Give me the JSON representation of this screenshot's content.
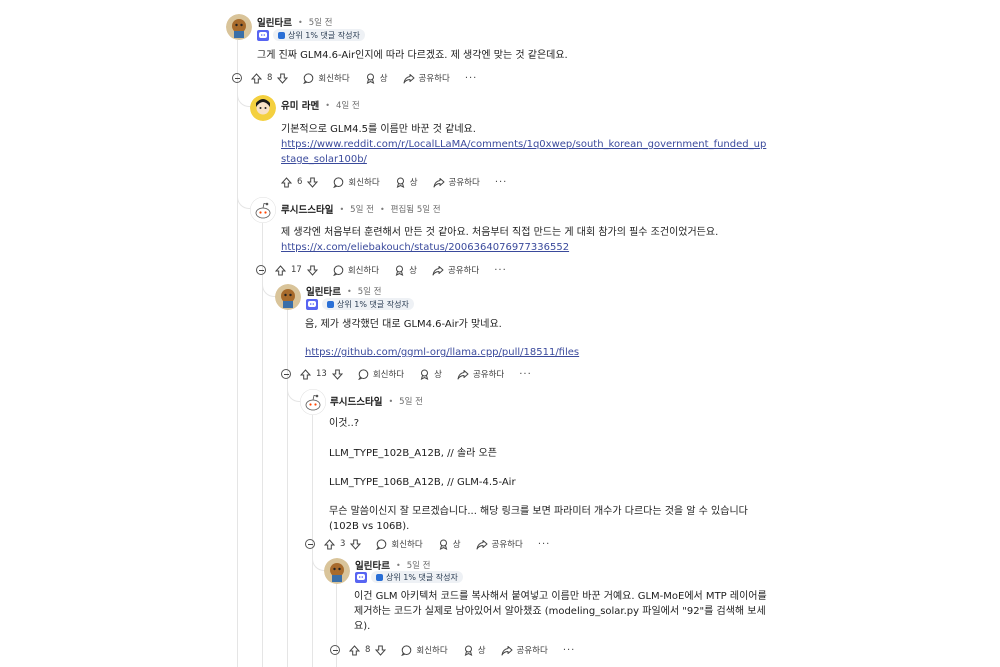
{
  "comments": [
    {
      "author": "일린타르",
      "time": "5일 전",
      "flair": "상위 1% 댓글 작성자",
      "body": [
        "그게 진짜 GLM4.6-Air인지에 따라 다르겠죠. 제 생각엔 맞는 것 같은데요."
      ],
      "votes": "8"
    },
    {
      "author": "유미 라멘",
      "time": "4일 전",
      "body": [
        "기본적으로 GLM4.5를 이름만 바꾼 것 같네요."
      ],
      "link": "https://www.reddit.com/r/LocalLLaMA/comments/1q0xwep/south_korean_government_funded_upstage_solar100b/",
      "votes": "6"
    },
    {
      "author": "루시드스타일",
      "time": "5일 전",
      "edited": "편집됨 5일 전",
      "body": [
        "제 생각엔 처음부터 훈련해서 만든 것 같아요. 처음부터 직접 만드는 게 대회 참가의 필수 조건이었거든요."
      ],
      "link": "https://x.com/eliebakouch/status/2006364076977336552",
      "votes": "17"
    },
    {
      "author": "일린타르",
      "time": "5일 전",
      "flair": "상위 1% 댓글 작성자",
      "body": [
        "음, 제가 생각했던 대로 GLM4.6-Air가 맞네요."
      ],
      "link": "https://github.com/ggml-org/llama.cpp/pull/18511/files",
      "votes": "13"
    },
    {
      "author": "루시드스타일",
      "time": "5일 전",
      "body": [
        "이것..?",
        "LLM_TYPE_102B_A12B, // 솔라 오픈",
        "LLM_TYPE_106B_A12B, // GLM-4.5-Air",
        "무슨 말씀이신지 잘 모르겠습니다... 해당 링크를 보면 파라미터 개수가 다르다는 것을 알 수 있습니다 (102B vs 106B)."
      ],
      "votes": "3"
    },
    {
      "author": "일린타르",
      "time": "5일 전",
      "flair": "상위 1% 댓글 작성자",
      "body": [
        "이건 GLM 아키텍처 코드를 복사해서 붙여넣고 이름만 바꾼 거예요. GLM-MoE에서 MTP 레이어를 제거하는 코드가 실제로 남아있어서 알아챘죠 (modeling_solar.py 파일에서 \"92\"를 검색해 보세요)."
      ],
      "votes": "8"
    }
  ],
  "actions": {
    "reply": "회신하다",
    "award": "상",
    "share": "공유하다",
    "more": "···"
  }
}
